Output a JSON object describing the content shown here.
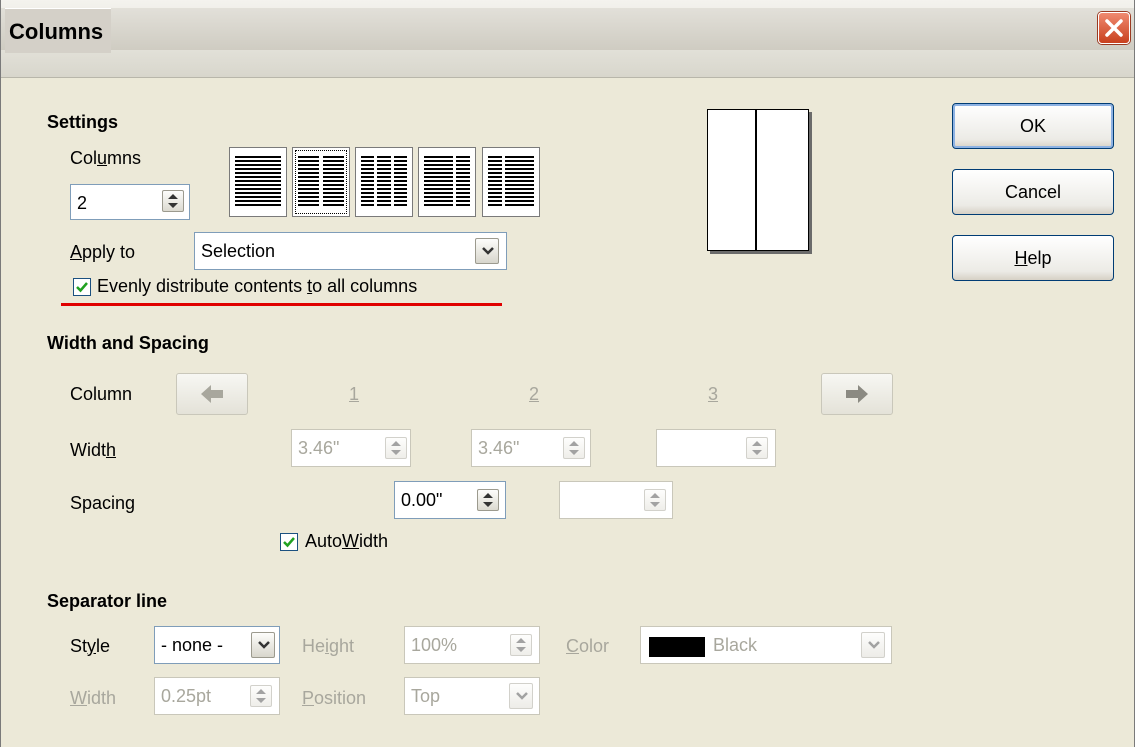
{
  "window": {
    "title": "Columns"
  },
  "buttons": {
    "ok": "OK",
    "cancel": "Cancel",
    "help_pre": "",
    "help_u": "H",
    "help_post": "elp"
  },
  "settings": {
    "heading": "Settings",
    "columns_pre": "Col",
    "columns_u": "u",
    "columns_post": "mns",
    "columns_value": "2",
    "layouts": [
      "one-column",
      "two-columns-equal",
      "three-columns-equal",
      "two-columns-left-wide",
      "two-columns-right-wide"
    ],
    "selected_layout": "two-columns-equal",
    "apply_to_pre": "",
    "apply_to_u": "A",
    "apply_to_post": "pply to",
    "apply_to_value": "Selection",
    "evenly_pre": "Evenly distribute contents ",
    "evenly_u": "t",
    "evenly_post": "o all columns",
    "evenly_checked": true
  },
  "width_spacing": {
    "heading": "Width and Spacing",
    "column_label": "Column",
    "col1": "1",
    "col2": "2",
    "col3": "3",
    "width_pre": "Widt",
    "width_u": "h",
    "width_post": "",
    "width1": "3.46\"",
    "width2": "3.46\"",
    "width3": "",
    "spacing_label": "Spacing",
    "spacing1": "0.00\"",
    "spacing2": "",
    "autowidth_pre": "Auto",
    "autowidth_u": "W",
    "autowidth_post": "idth",
    "autowidth_checked": true
  },
  "separator": {
    "heading": "Separator line",
    "style_pre": "St",
    "style_u": "y",
    "style_post": "le",
    "style_value": "- none -",
    "height_pre": "He",
    "height_u": "i",
    "height_post": "ght",
    "height_value": "100%",
    "color_pre": "",
    "color_u": "C",
    "color_post": "olor",
    "color_value": "Black",
    "color_swatch": "#000000",
    "width_pre": "",
    "width_u": "W",
    "width_post": "idth",
    "width_value": "0.25pt",
    "position_pre": "",
    "position_u": "P",
    "position_post": "osition",
    "position_value": "Top"
  }
}
